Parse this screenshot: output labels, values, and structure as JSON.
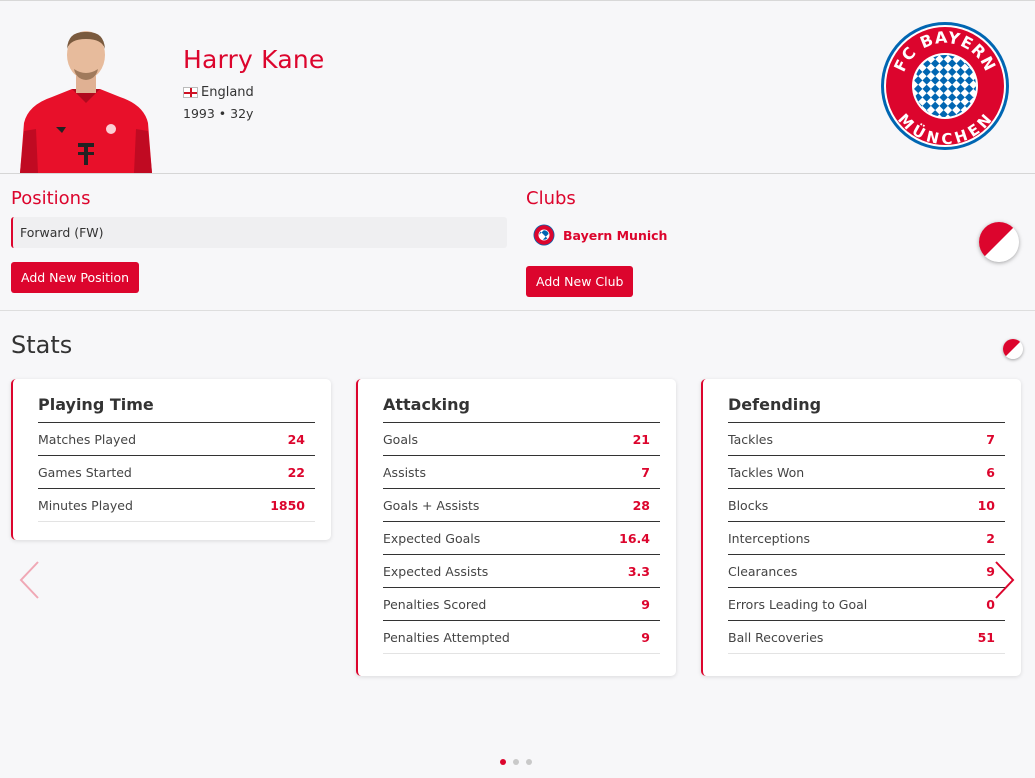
{
  "player": {
    "name": "Harry Kane",
    "nationality": "England",
    "age_line": "1993 • 32y"
  },
  "positions": {
    "title": "Positions",
    "items": [
      "Forward (FW)"
    ],
    "add_label": "Add New Position"
  },
  "clubs": {
    "title": "Clubs",
    "items": [
      "Bayern Munich"
    ],
    "add_label": "Add New Club"
  },
  "club_logo": {
    "top_text": "FC BAYERN",
    "bottom_text": "MÜNCHEN"
  },
  "stats": {
    "title": "Stats",
    "cards": [
      {
        "title": "Playing Time",
        "rows": [
          {
            "label": "Matches Played",
            "value": "24"
          },
          {
            "label": "Games Started",
            "value": "22"
          },
          {
            "label": "Minutes Played",
            "value": "1850"
          }
        ]
      },
      {
        "title": "Attacking",
        "rows": [
          {
            "label": "Goals",
            "value": "21"
          },
          {
            "label": "Assists",
            "value": "7"
          },
          {
            "label": "Goals + Assists",
            "value": "28"
          },
          {
            "label": "Expected Goals",
            "value": "16.4"
          },
          {
            "label": "Expected Assists",
            "value": "3.3"
          },
          {
            "label": "Penalties Scored",
            "value": "9"
          },
          {
            "label": "Penalties Attempted",
            "value": "9"
          }
        ]
      },
      {
        "title": "Defending",
        "rows": [
          {
            "label": "Tackles",
            "value": "7"
          },
          {
            "label": "Tackles Won",
            "value": "6"
          },
          {
            "label": "Blocks",
            "value": "10"
          },
          {
            "label": "Interceptions",
            "value": "2"
          },
          {
            "label": "Clearances",
            "value": "9"
          },
          {
            "label": "Errors Leading to Goal",
            "value": "0"
          },
          {
            "label": "Ball Recoveries",
            "value": "51"
          }
        ]
      }
    ]
  },
  "carousel": {
    "pages": 3,
    "active_page": 1
  },
  "colors": {
    "accent": "#dc052d",
    "logo_blue": "#0066b2",
    "background": "#f7f7f9"
  },
  "icons": {
    "prev": "chevron-left-icon",
    "next": "chevron-right-icon",
    "theme_toggle": "half-circle-icon"
  }
}
